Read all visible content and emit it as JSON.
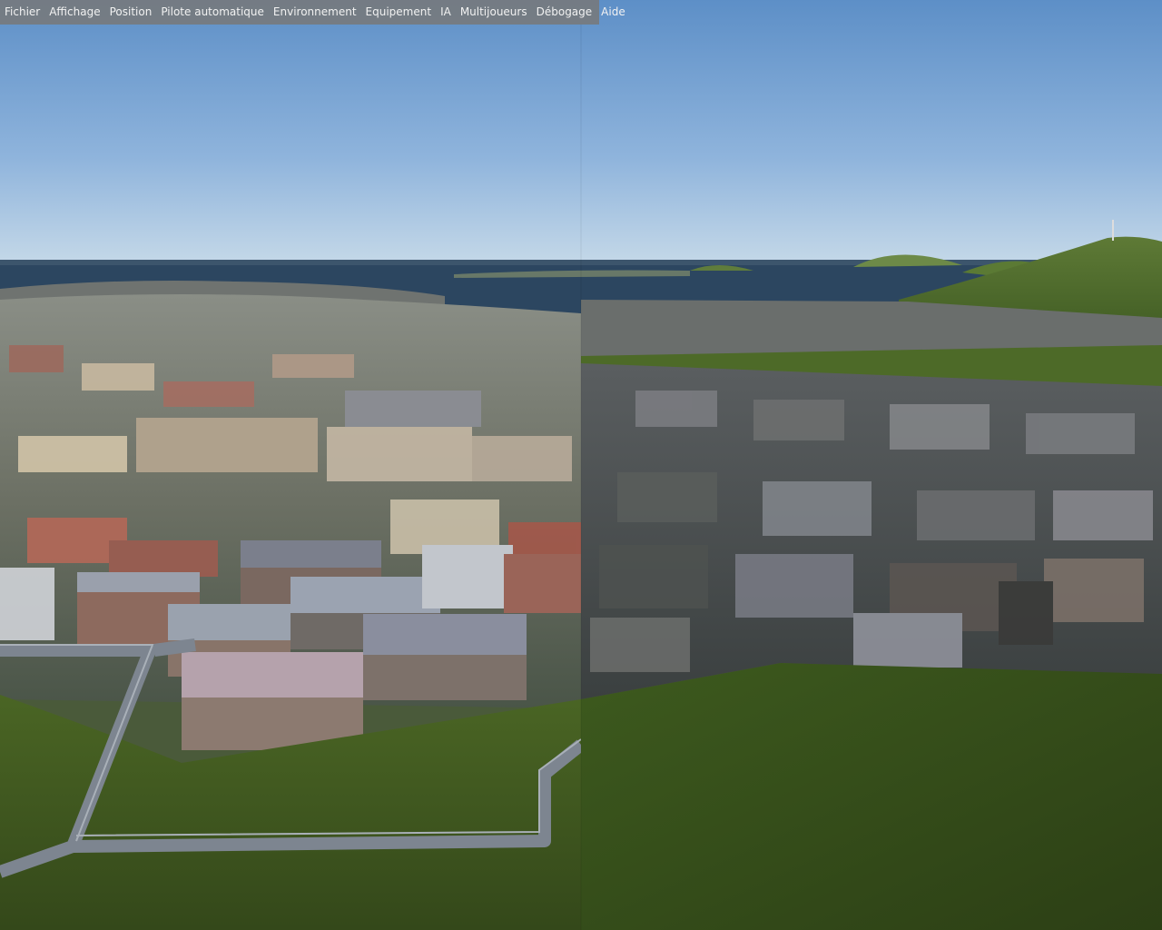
{
  "menubar": {
    "items": [
      {
        "label": "Fichier"
      },
      {
        "label": "Affichage"
      },
      {
        "label": "Position"
      },
      {
        "label": "Pilote automatique"
      },
      {
        "label": "Environnement"
      },
      {
        "label": "Equipement"
      },
      {
        "label": "IA"
      },
      {
        "label": "Multijoueurs"
      },
      {
        "label": "Débogage"
      },
      {
        "label": "Aide"
      }
    ]
  },
  "colors": {
    "menubar_bg": "#787878",
    "menu_text": "#f2f2f2",
    "sky_top": "#5e90c8",
    "sky_horizon": "#b9d2e6",
    "sea": "#2b4660",
    "grass": "#3f5a1f",
    "road": "#7d8590"
  }
}
